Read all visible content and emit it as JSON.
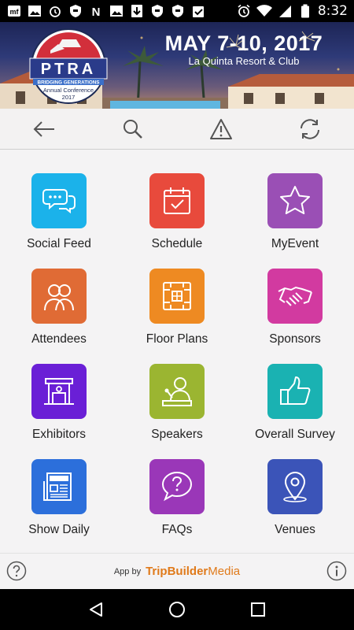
{
  "status_bar": {
    "time": "8:32",
    "left_icons": [
      "mw-app-icon",
      "gallery-icon",
      "alarm-icon",
      "shield-icon",
      "n-app-icon",
      "image-icon",
      "download-icon",
      "shield-icon",
      "shield-icon",
      "check-clipboard-icon"
    ],
    "right_icons": [
      "alarm-icon",
      "wifi-icon",
      "signal-icon",
      "battery-icon"
    ]
  },
  "banner": {
    "date": "MAY 7-10, 2017",
    "venue": "La Quinta Resort & Club",
    "logo": {
      "letters": "PTRA",
      "tagline": "BRIDGING GENERATIONS",
      "line1": "Annual Conference",
      "line2": "2017"
    }
  },
  "toolbar": {
    "buttons": [
      {
        "name": "back-icon"
      },
      {
        "name": "search-icon"
      },
      {
        "name": "alert-icon"
      },
      {
        "name": "refresh-icon"
      }
    ]
  },
  "tiles": [
    {
      "label": "Social Feed",
      "color": "#1bb2ea",
      "icon": "chat-bubbles-icon"
    },
    {
      "label": "Schedule",
      "color": "#e84a3c",
      "icon": "calendar-check-icon"
    },
    {
      "label": "MyEvent",
      "color": "#9a4fb5",
      "icon": "star-icon"
    },
    {
      "label": "Attendees",
      "color": "#e06b35",
      "icon": "people-icon"
    },
    {
      "label": "Floor Plans",
      "color": "#ee8a22",
      "icon": "floor-plan-icon"
    },
    {
      "label": "Sponsors",
      "color": "#d23aa0",
      "icon": "handshake-icon"
    },
    {
      "label": "Exhibitors",
      "color": "#6a1fd6",
      "icon": "booth-icon"
    },
    {
      "label": "Speakers",
      "color": "#9bb531",
      "icon": "speaker-podium-icon"
    },
    {
      "label": "Overall Survey",
      "color": "#1ab2b2",
      "icon": "thumbs-up-icon"
    },
    {
      "label": "Show Daily",
      "color": "#2c6fdb",
      "icon": "newspaper-icon"
    },
    {
      "label": "FAQs",
      "color": "#9a37b8",
      "icon": "question-bubble-icon"
    },
    {
      "label": "Venues",
      "color": "#3b54b8",
      "icon": "map-pin-icon"
    }
  ],
  "footer": {
    "app_by": "App by",
    "brand_bold": "TripBuilder",
    "brand_light": "Media"
  }
}
